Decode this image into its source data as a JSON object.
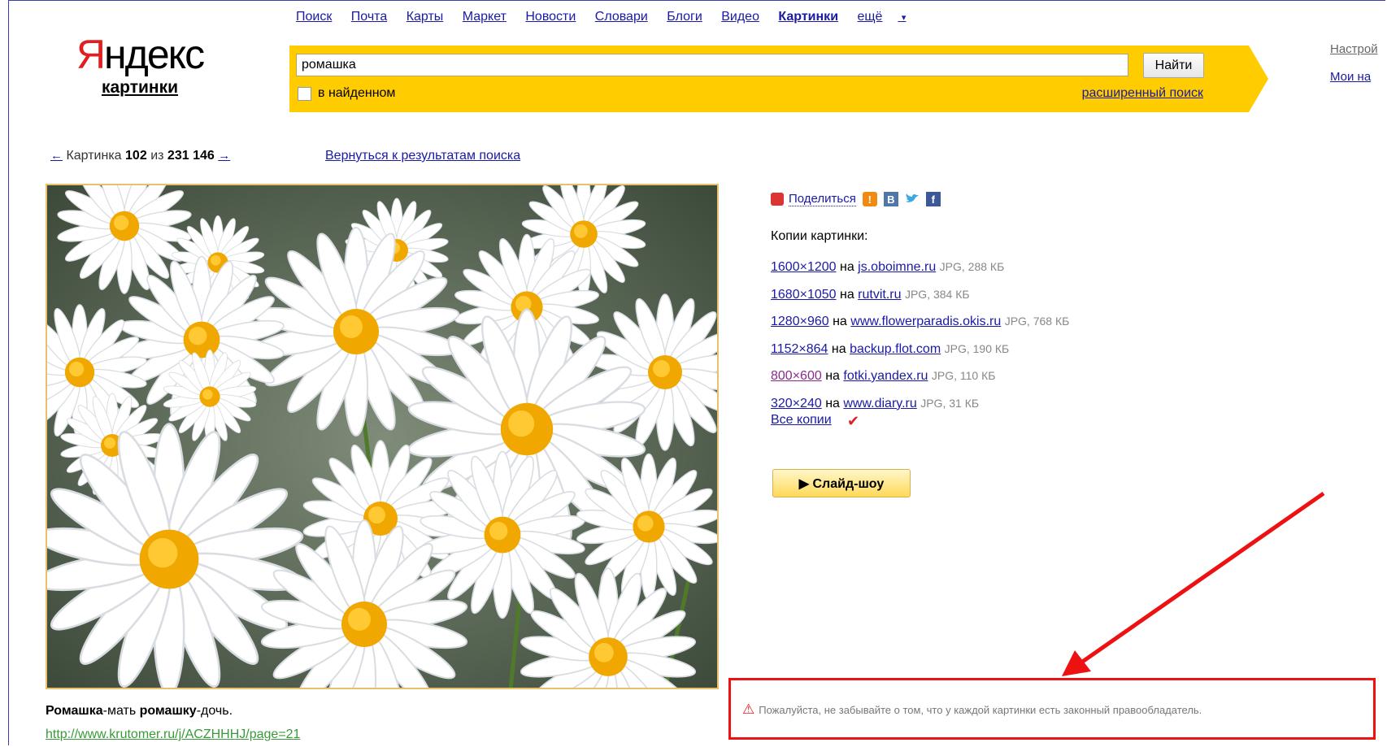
{
  "nav": {
    "items": [
      "Поиск",
      "Почта",
      "Карты",
      "Маркет",
      "Новости",
      "Словари",
      "Блоги",
      "Видео",
      "Картинки"
    ],
    "active": "Картинки",
    "more": "ещё",
    "more_arrow": "▾"
  },
  "logo": {
    "brand_first": "Я",
    "brand_rest": "ндекс",
    "service": "картинки"
  },
  "search": {
    "query": "ромашка",
    "button": "Найти",
    "in_found": "в найденном",
    "advanced": "расширенный поиск",
    "accent_color": "#ffcc00"
  },
  "right_links": {
    "settings": "Настрой",
    "mine": "Мои на"
  },
  "pager": {
    "prev": "←",
    "prefix": "Картинка",
    "current": "102",
    "of": "из",
    "total": "231 146",
    "next": "→",
    "back": "Вернуться к результатам поиска"
  },
  "image": {
    "caption_bold1": "Ромашка",
    "caption_mid": "-мать ",
    "caption_bold2": "ромашку",
    "caption_end": "-дочь.",
    "source_url": "http://www.krutomer.ru/j/ACZHHHJ/page=21"
  },
  "share": {
    "label": "Поделиться",
    "icons": [
      "share-icon",
      "odnoklassniki-icon",
      "vk-icon",
      "twitter-icon",
      "facebook-icon"
    ]
  },
  "copies": {
    "title": "Копии картинки:",
    "on": "на",
    "items": [
      {
        "res": "1600×1200",
        "site": "js.oboimne.ru",
        "meta": "JPG, 288 КБ"
      },
      {
        "res": "1680×1050",
        "site": "rutvit.ru",
        "meta": "JPG, 384 КБ"
      },
      {
        "res": "1280×960",
        "site": "www.flowerparadis.okis.ru",
        "meta": "JPG, 768 КБ"
      },
      {
        "res": "1152×864",
        "site": "backup.flot.com",
        "meta": "JPG, 190 КБ"
      },
      {
        "res": "800×600",
        "site": "fotki.yandex.ru",
        "meta": "JPG, 110 КБ"
      },
      {
        "res": "320×240",
        "site": "www.diary.ru",
        "meta": "JPG, 31 КБ"
      }
    ],
    "all": "Все копии"
  },
  "slideshow": "▶ Слайд-шоу",
  "notice": "Пожалуйста, не забывайте о том, что у каждой картинки есть законный правообладатель.",
  "annotation_color": "#ee1111"
}
